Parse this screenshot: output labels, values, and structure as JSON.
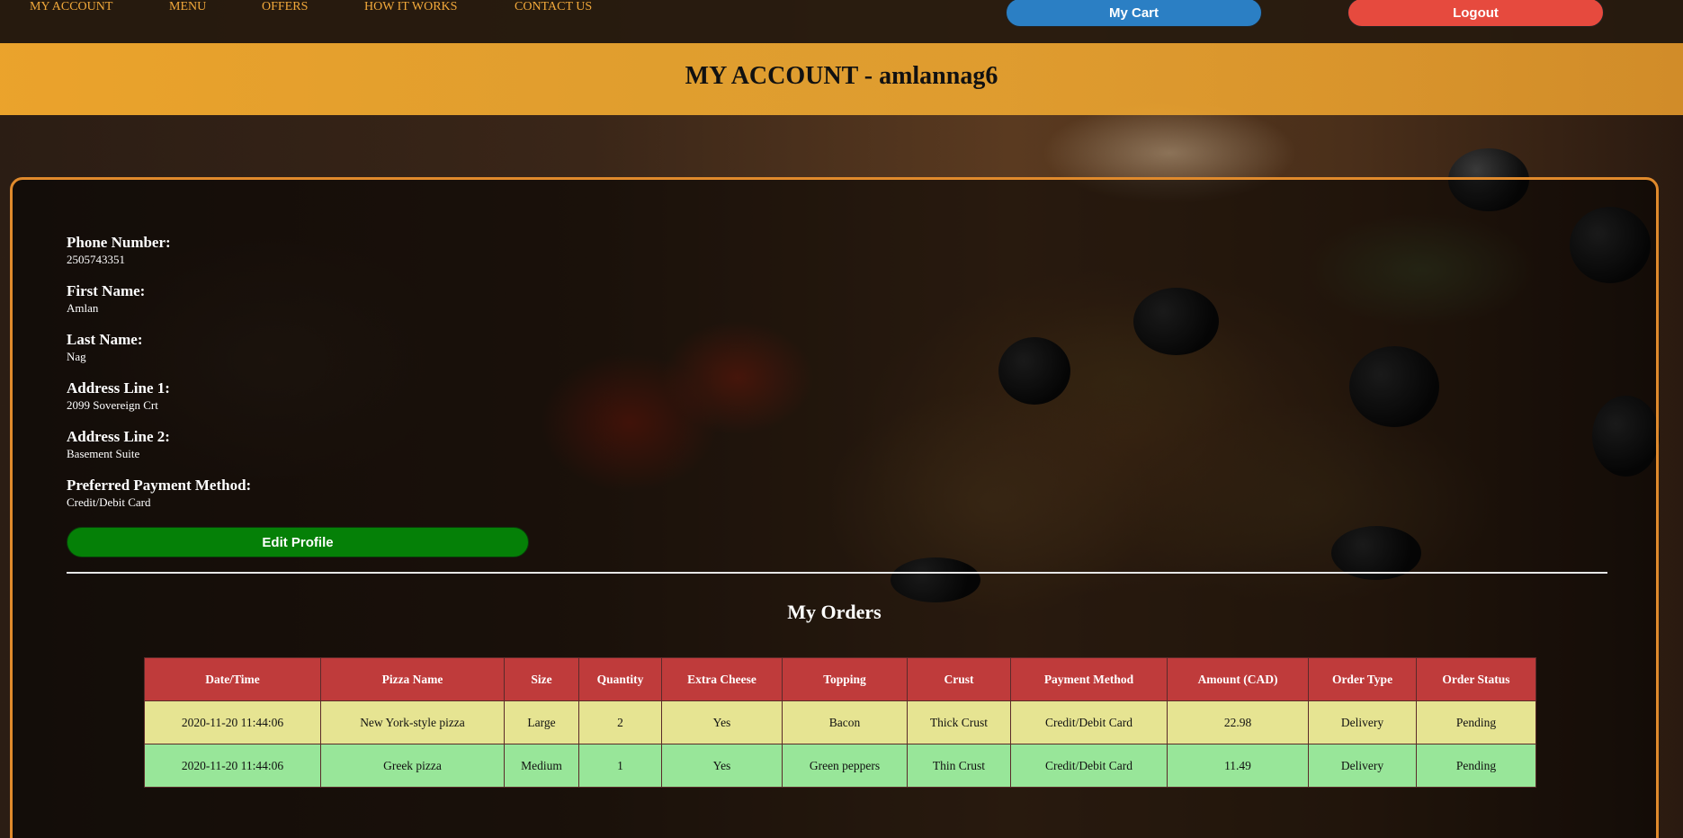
{
  "nav": {
    "items": [
      "MY ACCOUNT",
      "MENU",
      "OFFERS",
      "HOW IT WORKS",
      "CONTACT US"
    ],
    "cart_label": "My Cart",
    "logout_label": "Logout",
    "cart_color": "#2b7fc4",
    "logout_color": "#e64a3e"
  },
  "banner": {
    "title": "MY ACCOUNT - amlannag6"
  },
  "profile": {
    "fields": [
      {
        "label": "Phone Number:",
        "value": "2505743351"
      },
      {
        "label": "First Name:",
        "value": "Amlan"
      },
      {
        "label": "Last Name:",
        "value": "Nag"
      },
      {
        "label": "Address Line 1:",
        "value": "2099 Sovereign Crt"
      },
      {
        "label": "Address Line 2:",
        "value": "Basement Suite"
      },
      {
        "label": "Preferred Payment Method:",
        "value": "Credit/Debit Card"
      }
    ],
    "edit_label": "Edit Profile"
  },
  "orders": {
    "title": "My Orders",
    "headers": [
      "Date/Time",
      "Pizza Name",
      "Size",
      "Quantity",
      "Extra Cheese",
      "Topping",
      "Crust",
      "Payment Method",
      "Amount (CAD)",
      "Order Type",
      "Order Status"
    ],
    "rows": [
      [
        "2020-11-20 11:44:06",
        "New York-style pizza",
        "Large",
        "2",
        "Yes",
        "Bacon",
        "Thick Crust",
        "Credit/Debit Card",
        "22.98",
        "Delivery",
        "Pending"
      ],
      [
        "2020-11-20 11:44:06",
        "Greek pizza",
        "Medium",
        "1",
        "Yes",
        "Green peppers",
        "Thin Crust",
        "Credit/Debit Card",
        "11.49",
        "Delivery",
        "Pending"
      ]
    ]
  }
}
